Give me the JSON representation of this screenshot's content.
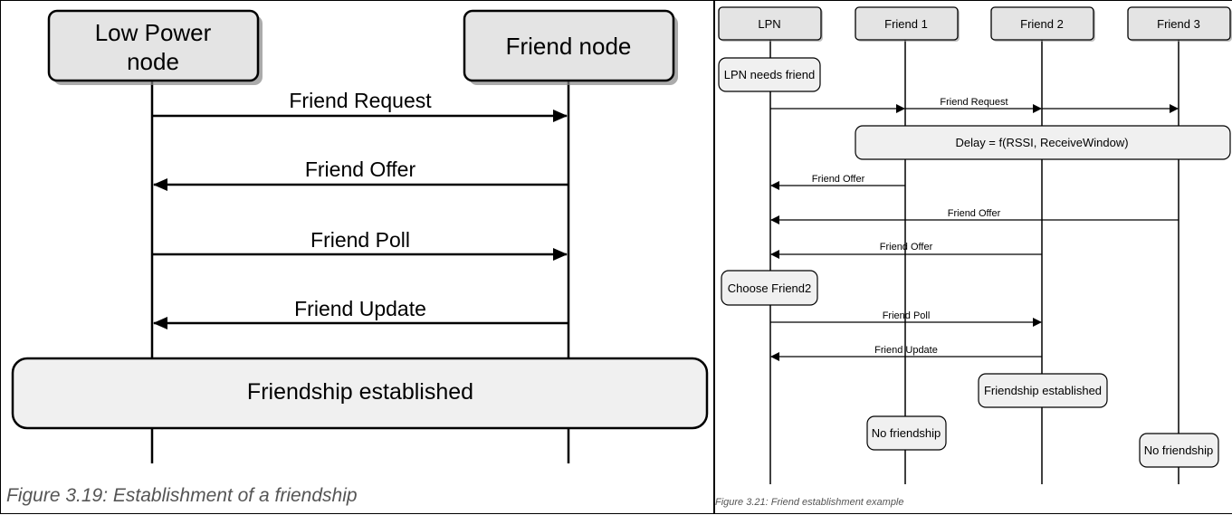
{
  "left_figure": {
    "participants": [
      "Low Power node",
      "Friend node"
    ],
    "participant_lines": [
      [
        "Low Power",
        "node"
      ],
      [
        "Friend node"
      ]
    ],
    "messages": [
      {
        "label": "Friend Request",
        "from": 0,
        "to": 1
      },
      {
        "label": "Friend Offer",
        "from": 1,
        "to": 0
      },
      {
        "label": "Friend Poll",
        "from": 0,
        "to": 1
      },
      {
        "label": "Friend Update",
        "from": 1,
        "to": 0
      }
    ],
    "state_box": "Friendship established",
    "caption": "Figure 3.19: Establishment of a friendship"
  },
  "right_figure": {
    "participants": [
      "LPN",
      "Friend 1",
      "Friend 2",
      "Friend 3"
    ],
    "notes": {
      "lpn_needs_friend": "LPN needs friend",
      "delay": "Delay = f(RSSI, ReceiveWindow)",
      "choose_friend": "Choose Friend2",
      "friendship_established": "Friendship established",
      "no_friendship_1": "No friendship",
      "no_friendship_3": "No friendship"
    },
    "messages": [
      {
        "label": "Friend Request",
        "from": 0,
        "to": 3,
        "broadcast": true
      },
      {
        "label": "Friend Offer",
        "from": 1,
        "to": 0
      },
      {
        "label": "Friend Offer",
        "from": 3,
        "to": 0
      },
      {
        "label": "Friend Offer",
        "from": 2,
        "to": 0
      },
      {
        "label": "Friend Poll",
        "from": 0,
        "to": 2
      },
      {
        "label": "Friend Update",
        "from": 2,
        "to": 0
      }
    ],
    "caption": "Figure 3.21: Friend establishment example"
  },
  "colors": {
    "box_fill": "#e4e4e4",
    "note_fill": "#f0f0f0",
    "line": "#000000",
    "caption": "#555555"
  }
}
